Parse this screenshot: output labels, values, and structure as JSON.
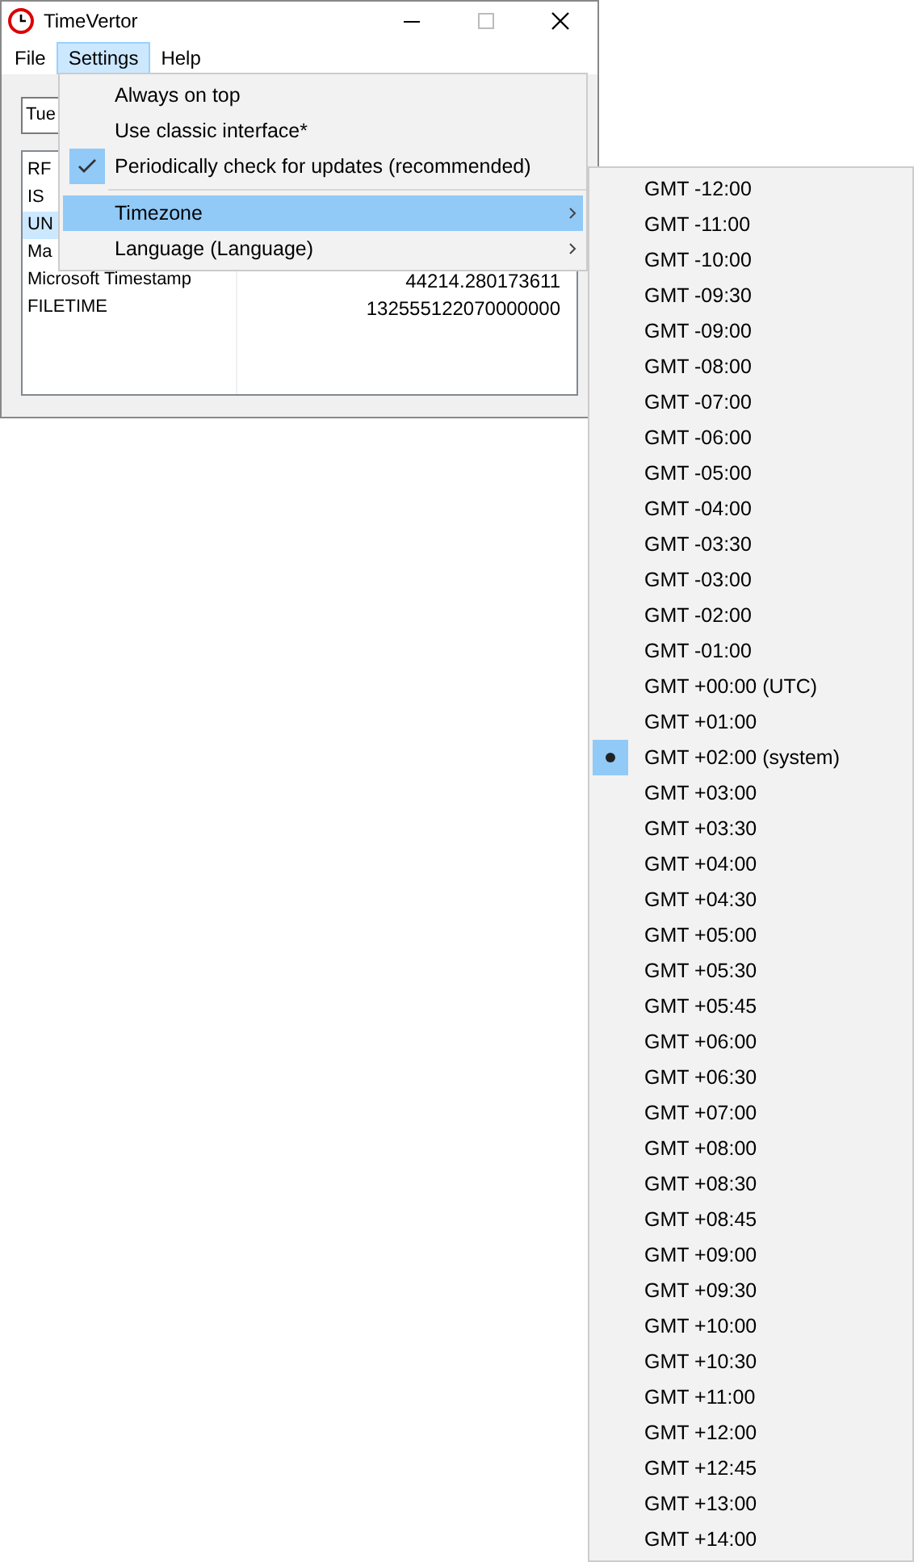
{
  "window": {
    "title": "TimeVertor"
  },
  "menu_bar": [
    {
      "label": "File",
      "selected": false
    },
    {
      "label": "Settings",
      "selected": true
    },
    {
      "label": "Help",
      "selected": false
    }
  ],
  "date_field": {
    "value": "Tue"
  },
  "list": [
    {
      "name": "RF",
      "selected": false
    },
    {
      "name": "IS",
      "selected": false
    },
    {
      "name": "UN",
      "selected": true
    },
    {
      "name": "Ma",
      "selected": false
    },
    {
      "name": "Microsoft Timestamp",
      "value": "44214.280173611",
      "selected": false
    },
    {
      "name": "FILETIME",
      "value": "132555122070000000",
      "selected": false
    }
  ],
  "settings_menu": [
    {
      "kind": "item",
      "label": "Always on top",
      "checked": false,
      "selected": false
    },
    {
      "kind": "item",
      "label": "Use classic interface*",
      "checked": false,
      "selected": false
    },
    {
      "kind": "item",
      "label": "Periodically check for updates (recommended)",
      "checked": true,
      "selected": false
    },
    {
      "kind": "separator"
    },
    {
      "kind": "submenu",
      "label": "Timezone",
      "selected": true
    },
    {
      "kind": "submenu",
      "label": "Language (Language)",
      "selected": false
    }
  ],
  "timezone_menu": [
    {
      "label": "GMT -12:00",
      "selected": false
    },
    {
      "label": "GMT -11:00",
      "selected": false
    },
    {
      "label": "GMT -10:00",
      "selected": false
    },
    {
      "label": "GMT -09:30",
      "selected": false
    },
    {
      "label": "GMT -09:00",
      "selected": false
    },
    {
      "label": "GMT -08:00",
      "selected": false
    },
    {
      "label": "GMT -07:00",
      "selected": false
    },
    {
      "label": "GMT -06:00",
      "selected": false
    },
    {
      "label": "GMT -05:00",
      "selected": false
    },
    {
      "label": "GMT -04:00",
      "selected": false
    },
    {
      "label": "GMT -03:30",
      "selected": false
    },
    {
      "label": "GMT -03:00",
      "selected": false
    },
    {
      "label": "GMT -02:00",
      "selected": false
    },
    {
      "label": "GMT -01:00",
      "selected": false
    },
    {
      "label": "GMT +00:00 (UTC)",
      "selected": false
    },
    {
      "label": "GMT +01:00",
      "selected": false
    },
    {
      "label": "GMT +02:00 (system)",
      "selected": true
    },
    {
      "label": "GMT +03:00",
      "selected": false
    },
    {
      "label": "GMT +03:30",
      "selected": false
    },
    {
      "label": "GMT +04:00",
      "selected": false
    },
    {
      "label": "GMT +04:30",
      "selected": false
    },
    {
      "label": "GMT +05:00",
      "selected": false
    },
    {
      "label": "GMT +05:30",
      "selected": false
    },
    {
      "label": "GMT +05:45",
      "selected": false
    },
    {
      "label": "GMT +06:00",
      "selected": false
    },
    {
      "label": "GMT +06:30",
      "selected": false
    },
    {
      "label": "GMT +07:00",
      "selected": false
    },
    {
      "label": "GMT +08:00",
      "selected": false
    },
    {
      "label": "GMT +08:30",
      "selected": false
    },
    {
      "label": "GMT +08:45",
      "selected": false
    },
    {
      "label": "GMT +09:00",
      "selected": false
    },
    {
      "label": "GMT +09:30",
      "selected": false
    },
    {
      "label": "GMT +10:00",
      "selected": false
    },
    {
      "label": "GMT +10:30",
      "selected": false
    },
    {
      "label": "GMT +11:00",
      "selected": false
    },
    {
      "label": "GMT +12:00",
      "selected": false
    },
    {
      "label": "GMT +12:45",
      "selected": false
    },
    {
      "label": "GMT +13:00",
      "selected": false
    },
    {
      "label": "GMT +14:00",
      "selected": false
    }
  ]
}
